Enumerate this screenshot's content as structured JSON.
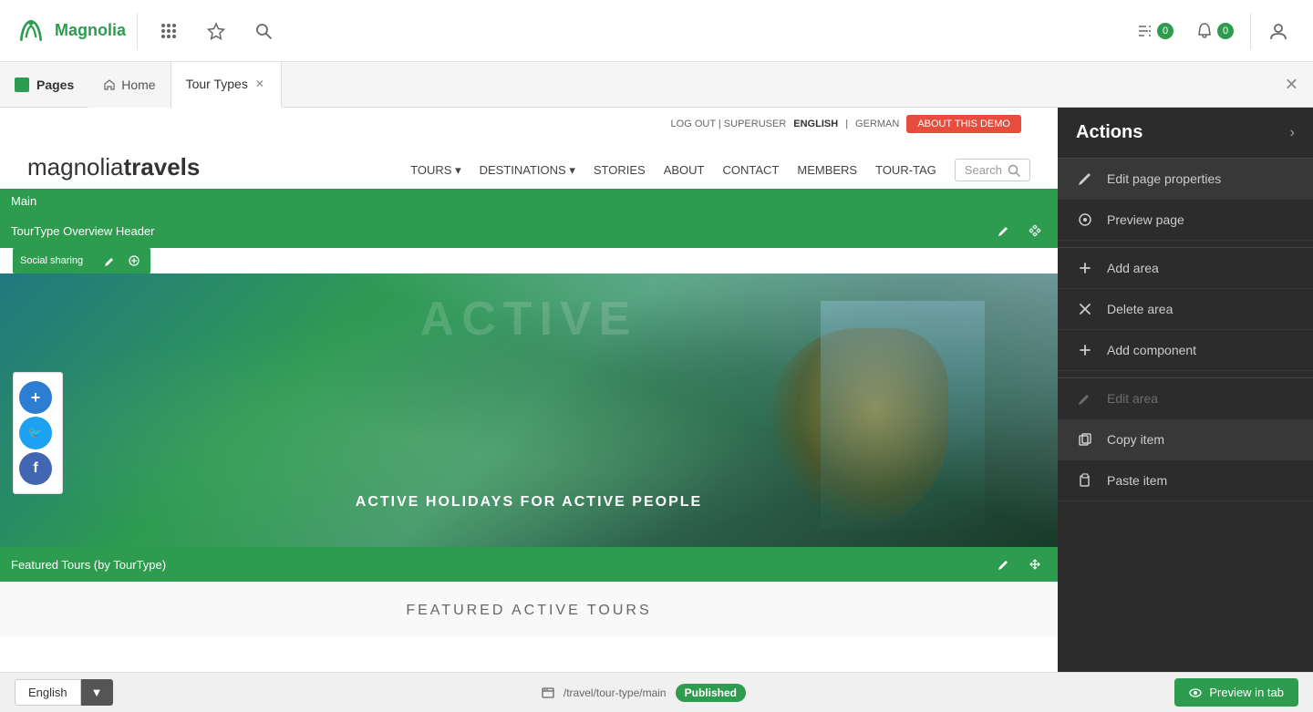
{
  "topbar": {
    "logo_alt": "Magnolia",
    "apps_icon": "⠿",
    "star_icon": "☆",
    "search_icon": "🔍",
    "tasks_label": "0",
    "notifications_label": "0"
  },
  "tabbar": {
    "pages_label": "Pages",
    "close_icon": "✕",
    "tabs": [
      {
        "id": "home",
        "label": "Home",
        "icon": "🏠",
        "active": false,
        "closeable": false
      },
      {
        "id": "tour-types",
        "label": "Tour Types",
        "active": true,
        "closeable": true
      }
    ]
  },
  "site": {
    "top_info": "LOG OUT | SUPERUSER",
    "lang_active": "ENGLISH",
    "lang_separator": "|",
    "lang_other": "GERMAN",
    "about_demo": "ABOUT THIS DEMO",
    "logo_part1": "magnolia",
    "logo_part2": "travels",
    "nav": [
      "TOURS",
      "DESTINATIONS",
      "STORIES",
      "ABOUT",
      "CONTACT",
      "MEMBERS",
      "TOUR-TAG"
    ],
    "search_placeholder": "Search",
    "hero_bg_text": "ACTIVE",
    "hero_subtitle": "ACTIVE HOLIDAYS FOR ACTIVE PEOPLE",
    "featured_title": "FEATURED ACTIVE TOURS"
  },
  "components": {
    "main_label": "Main",
    "toutype_header_label": "TourType Overview Header",
    "social_sharing_label": "Social sharing",
    "featured_tours_label": "Featured Tours (by TourType)"
  },
  "social": {
    "share_icon": "+",
    "twitter_icon": "🐦",
    "facebook_icon": "f"
  },
  "actions": {
    "title": "Actions",
    "chevron": "›",
    "items": [
      {
        "id": "edit-page-properties",
        "icon": "✏️",
        "label": "Edit page properties",
        "active": true,
        "disabled": false
      },
      {
        "id": "preview-page",
        "icon": "👁",
        "label": "Preview page",
        "active": false,
        "disabled": false
      },
      {
        "id": "add-area",
        "icon": "+",
        "label": "Add area",
        "active": false,
        "disabled": false
      },
      {
        "id": "delete-area",
        "icon": "✕",
        "label": "Delete area",
        "active": false,
        "disabled": false
      },
      {
        "id": "add-component",
        "icon": "+",
        "label": "Add component",
        "active": false,
        "disabled": false
      },
      {
        "id": "edit-area",
        "icon": "✏️",
        "label": "Edit area",
        "active": false,
        "disabled": true
      },
      {
        "id": "copy-item",
        "icon": "📋",
        "label": "Copy item",
        "active": true,
        "disabled": false
      },
      {
        "id": "paste-item",
        "icon": "📄",
        "label": "Paste item",
        "active": false,
        "disabled": false
      }
    ]
  },
  "bottom": {
    "lang_label": "English",
    "lang_arrow": "▼",
    "path": "/travel/tour-type/main",
    "status": "Published",
    "preview_label": "Preview in tab",
    "preview_icon": "👁"
  }
}
